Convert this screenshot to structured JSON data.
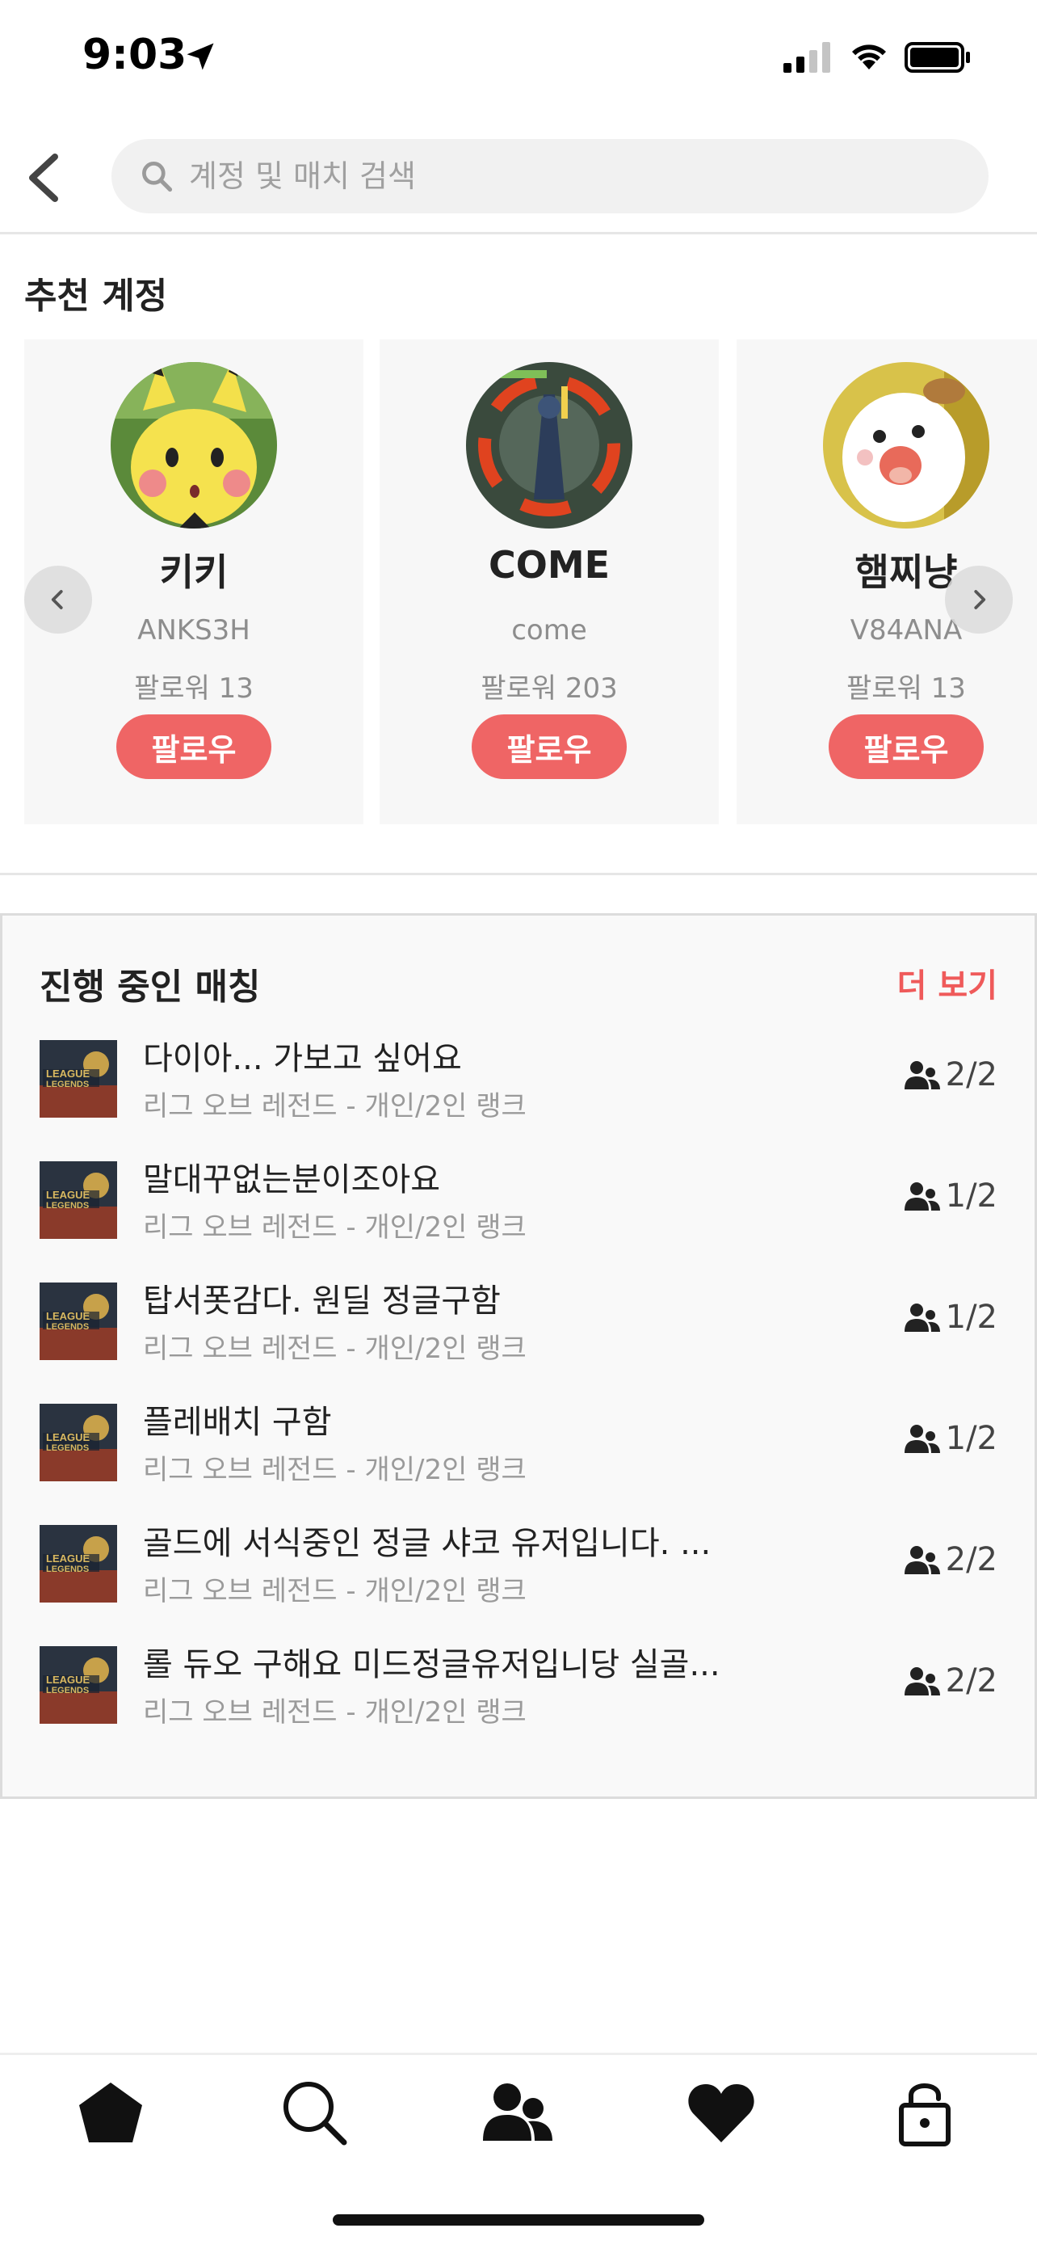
{
  "status_bar": {
    "time": "9:03"
  },
  "search": {
    "placeholder": "계정 및 매치 검색"
  },
  "recommended": {
    "title": "추천 계정",
    "accounts": [
      {
        "name": "키키",
        "id": "ANKS3H",
        "followers": "팔로워 13",
        "follow_label": "팔로우"
      },
      {
        "name": "COME",
        "id": "come",
        "followers": "팔로워 203",
        "follow_label": "팔로우"
      },
      {
        "name": "햄찌냥",
        "id": "V84ANA",
        "followers": "팔로워 13",
        "follow_label": "팔로우"
      }
    ]
  },
  "matches": {
    "title": "진행 중인 매칭",
    "more_label": "더 보기",
    "items": [
      {
        "title": "다이아... 가보고 싶어요",
        "subtitle": "리그 오브 레전드 - 개인/2인 랭크",
        "count": "2/2"
      },
      {
        "title": "말대꾸없는분이조아요",
        "subtitle": "리그 오브 레전드 - 개인/2인 랭크",
        "count": "1/2"
      },
      {
        "title": "탑서폿감다. 원딜 정글구함",
        "subtitle": "리그 오브 레전드 - 개인/2인 랭크",
        "count": "1/2"
      },
      {
        "title": "플레배치 구함",
        "subtitle": "리그 오브 레전드 - 개인/2인 랭크",
        "count": "1/2"
      },
      {
        "title": "골드에 서식중인 정글 샤코 유저입니다. ...",
        "subtitle": "리그 오브 레전드 - 개인/2인 랭크",
        "count": "2/2"
      },
      {
        "title": "롤 듀오 구해요 미드정글유저입니당 실골...",
        "subtitle": "리그 오브 레전드 - 개인/2인 랭크",
        "count": "2/2"
      }
    ]
  },
  "tab_bar": {
    "tabs": [
      "home-icon",
      "search-icon",
      "people-icon",
      "heart-icon",
      "lock-icon"
    ],
    "active": "people-icon"
  },
  "colors": {
    "accent": "#ef6565",
    "more_link": "#ef5a5a",
    "text": "#222222",
    "muted": "#9a9a9a"
  }
}
